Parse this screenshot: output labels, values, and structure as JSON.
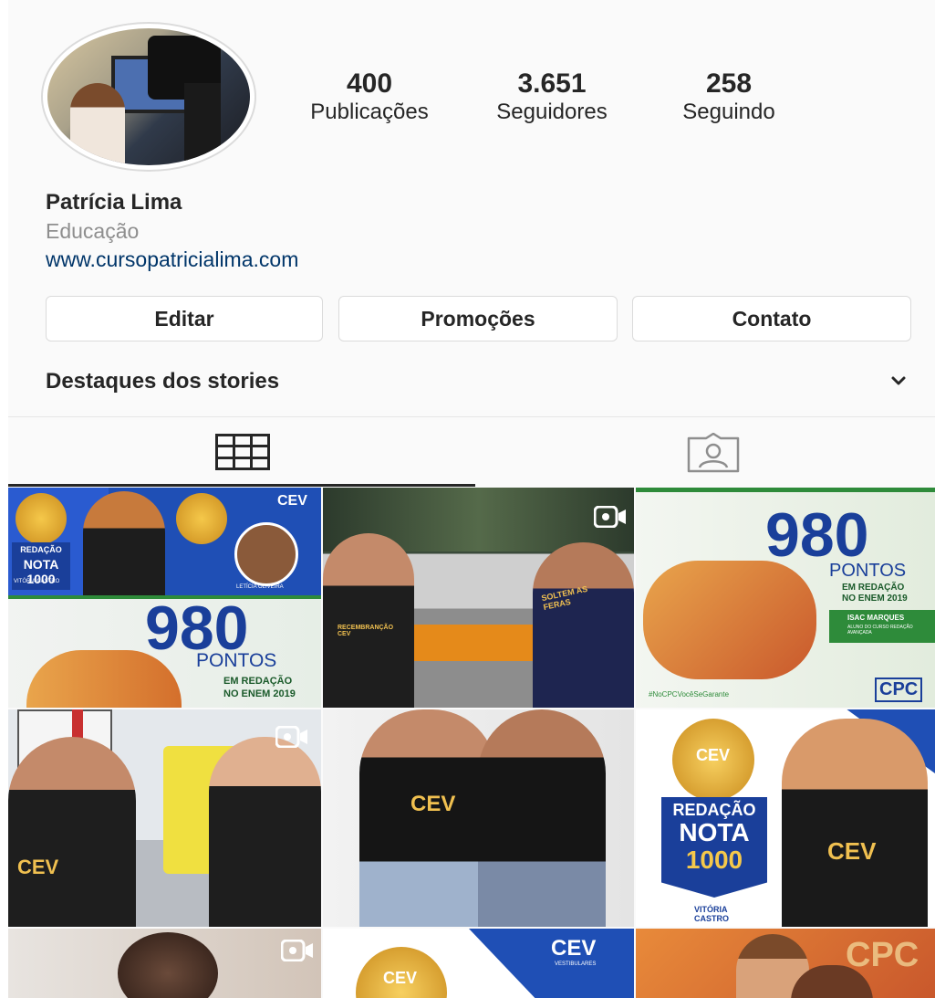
{
  "profile": {
    "name": "Patrícia Lima",
    "category": "Educação",
    "website": "www.cursopatricialima.com"
  },
  "stats": [
    {
      "value": "400",
      "label": "Publicações"
    },
    {
      "value": "3.651",
      "label": "Seguidores"
    },
    {
      "value": "258",
      "label": "Seguindo"
    }
  ],
  "buttons": {
    "edit": "Editar",
    "promotions": "Promoções",
    "contact": "Contato"
  },
  "highlights": {
    "label": "Destaques dos stories"
  },
  "tabs": [
    {
      "icon": "grid-icon",
      "active": true
    },
    {
      "icon": "tagged-icon",
      "active": false
    }
  ],
  "posts": {
    "p1": {
      "brand": "CEV",
      "badge_top": "REDAÇÃO",
      "badge_mid": "NOTA",
      "badge_num": "1000",
      "big": "980",
      "unit": "PONTOS",
      "sub1": "EM REDAÇÃO",
      "sub2": "NO ENEM 2019",
      "name1": "VITÓRIA CASTRO",
      "name2": "LETÍCIA OLIVEIRA"
    },
    "p2": {
      "shirt": "RECEMBRANÇÃO CEV",
      "sign": "SOLTEM AS FERAS"
    },
    "p3": {
      "big": "980",
      "unit": "PONTOS",
      "sub1": "EM REDAÇÃO",
      "sub2": "NO ENEM 2019",
      "student": "ISAC MARQUES",
      "student_sub": "ALUNO DO CURSO REDAÇÃO AVANÇADA",
      "hashtag": "#NoCPCVocêSeGarante",
      "brand": "CPC"
    },
    "p4": {
      "shirt": "CEV"
    },
    "p5": {
      "shirt": "CEV"
    },
    "p6": {
      "medal": "CEV",
      "line1": "REDAÇÃO",
      "line2": "NOTA",
      "line3": "1000",
      "name": "VITÓRIA CASTRO",
      "shirt": "CEV"
    },
    "p8": {
      "brand": "CEV",
      "brand_sub": "VESTIBULARES",
      "medal": "CEV"
    },
    "p9": {
      "brand": "CPC"
    }
  }
}
